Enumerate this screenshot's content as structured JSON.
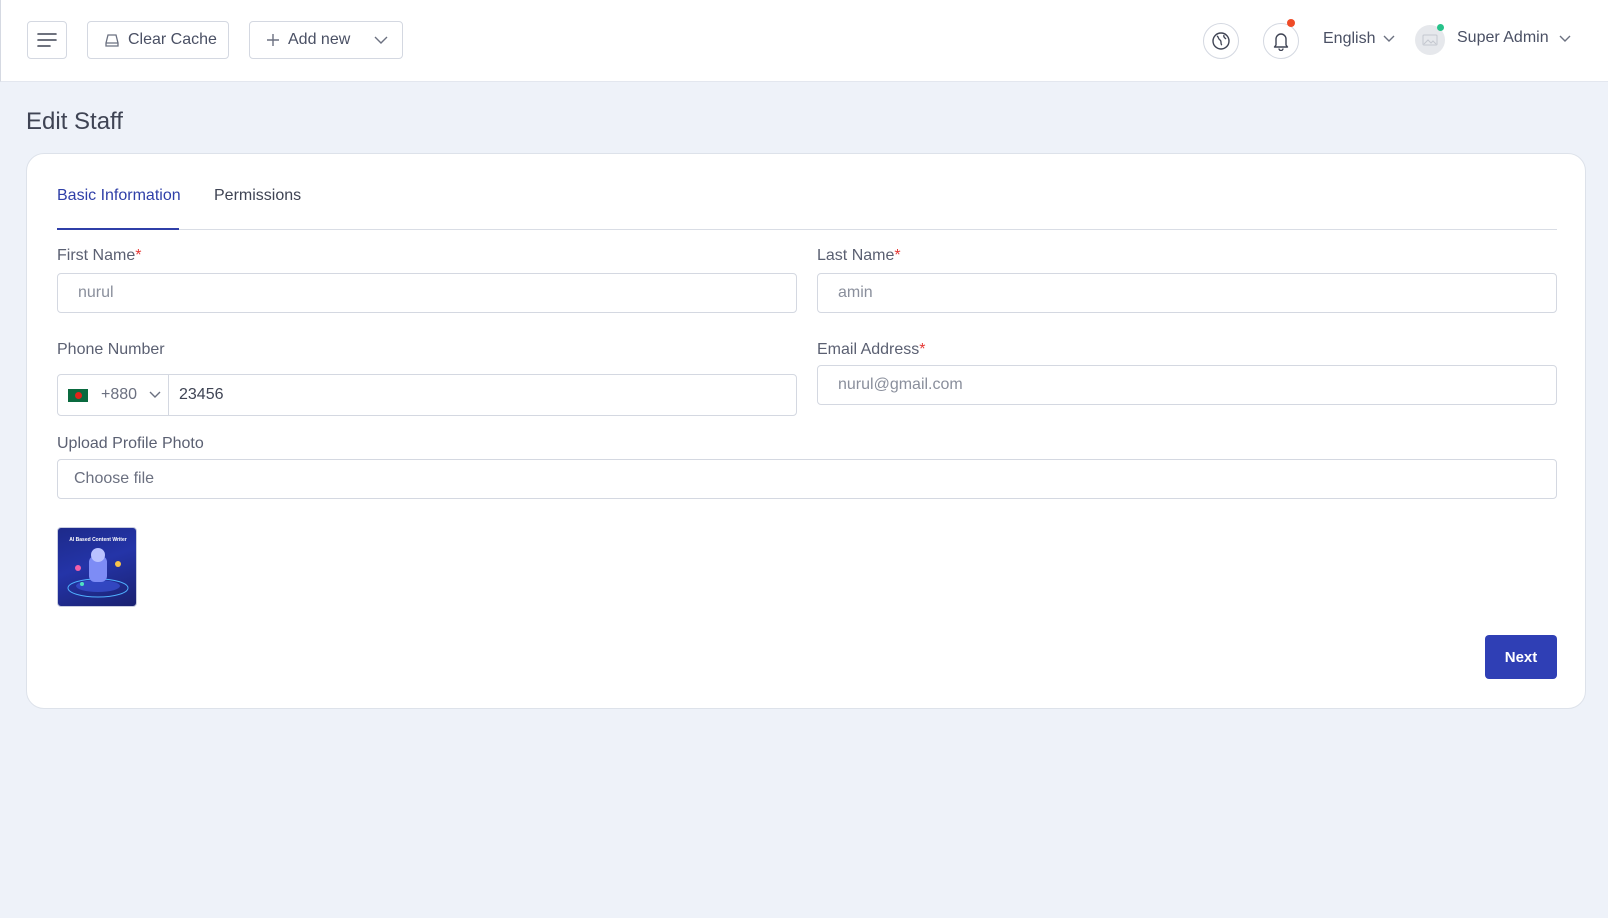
{
  "header": {
    "clear_cache_label": "Clear Cache",
    "add_new_label": "Add new",
    "language": "English",
    "user_name": "Super Admin",
    "notification_dot_color": "#ef4b27",
    "online_dot_color": "#27c28a"
  },
  "page": {
    "title": "Edit Staff"
  },
  "tabs": [
    {
      "label": "Basic Information",
      "active": true
    },
    {
      "label": "Permissions",
      "active": false
    }
  ],
  "form": {
    "first_name": {
      "label": "First Name",
      "required_mark": "*",
      "value": "nurul"
    },
    "last_name": {
      "label": "Last Name",
      "required_mark": "*",
      "value": "amin"
    },
    "phone": {
      "label": "Phone Number",
      "country_code": "+880",
      "value": "23456"
    },
    "email": {
      "label": "Email Address",
      "required_mark": "*",
      "value": "nurul@gmail.com"
    },
    "photo": {
      "label": "Upload Profile Photo",
      "placeholder": "Choose file"
    },
    "thumbnail_title": "AI Based Content Writer"
  },
  "actions": {
    "next_label": "Next"
  },
  "colors": {
    "accent": "#2f3fb5",
    "required": "#e53935",
    "background": "#eef2f9"
  }
}
